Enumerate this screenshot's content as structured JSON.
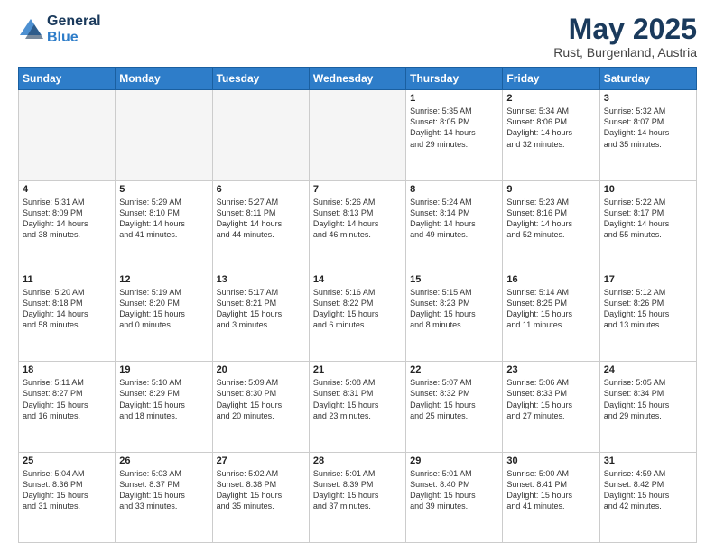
{
  "header": {
    "logo_line1": "General",
    "logo_line2": "Blue",
    "title": "May 2025",
    "subtitle": "Rust, Burgenland, Austria"
  },
  "columns": [
    "Sunday",
    "Monday",
    "Tuesday",
    "Wednesday",
    "Thursday",
    "Friday",
    "Saturday"
  ],
  "weeks": [
    [
      {
        "day": "",
        "text": "",
        "empty": true
      },
      {
        "day": "",
        "text": "",
        "empty": true
      },
      {
        "day": "",
        "text": "",
        "empty": true
      },
      {
        "day": "",
        "text": "",
        "empty": true
      },
      {
        "day": "1",
        "text": "Sunrise: 5:35 AM\nSunset: 8:05 PM\nDaylight: 14 hours\nand 29 minutes.",
        "empty": false
      },
      {
        "day": "2",
        "text": "Sunrise: 5:34 AM\nSunset: 8:06 PM\nDaylight: 14 hours\nand 32 minutes.",
        "empty": false
      },
      {
        "day": "3",
        "text": "Sunrise: 5:32 AM\nSunset: 8:07 PM\nDaylight: 14 hours\nand 35 minutes.",
        "empty": false
      }
    ],
    [
      {
        "day": "4",
        "text": "Sunrise: 5:31 AM\nSunset: 8:09 PM\nDaylight: 14 hours\nand 38 minutes.",
        "empty": false
      },
      {
        "day": "5",
        "text": "Sunrise: 5:29 AM\nSunset: 8:10 PM\nDaylight: 14 hours\nand 41 minutes.",
        "empty": false
      },
      {
        "day": "6",
        "text": "Sunrise: 5:27 AM\nSunset: 8:11 PM\nDaylight: 14 hours\nand 44 minutes.",
        "empty": false
      },
      {
        "day": "7",
        "text": "Sunrise: 5:26 AM\nSunset: 8:13 PM\nDaylight: 14 hours\nand 46 minutes.",
        "empty": false
      },
      {
        "day": "8",
        "text": "Sunrise: 5:24 AM\nSunset: 8:14 PM\nDaylight: 14 hours\nand 49 minutes.",
        "empty": false
      },
      {
        "day": "9",
        "text": "Sunrise: 5:23 AM\nSunset: 8:16 PM\nDaylight: 14 hours\nand 52 minutes.",
        "empty": false
      },
      {
        "day": "10",
        "text": "Sunrise: 5:22 AM\nSunset: 8:17 PM\nDaylight: 14 hours\nand 55 minutes.",
        "empty": false
      }
    ],
    [
      {
        "day": "11",
        "text": "Sunrise: 5:20 AM\nSunset: 8:18 PM\nDaylight: 14 hours\nand 58 minutes.",
        "empty": false
      },
      {
        "day": "12",
        "text": "Sunrise: 5:19 AM\nSunset: 8:20 PM\nDaylight: 15 hours\nand 0 minutes.",
        "empty": false
      },
      {
        "day": "13",
        "text": "Sunrise: 5:17 AM\nSunset: 8:21 PM\nDaylight: 15 hours\nand 3 minutes.",
        "empty": false
      },
      {
        "day": "14",
        "text": "Sunrise: 5:16 AM\nSunset: 8:22 PM\nDaylight: 15 hours\nand 6 minutes.",
        "empty": false
      },
      {
        "day": "15",
        "text": "Sunrise: 5:15 AM\nSunset: 8:23 PM\nDaylight: 15 hours\nand 8 minutes.",
        "empty": false
      },
      {
        "day": "16",
        "text": "Sunrise: 5:14 AM\nSunset: 8:25 PM\nDaylight: 15 hours\nand 11 minutes.",
        "empty": false
      },
      {
        "day": "17",
        "text": "Sunrise: 5:12 AM\nSunset: 8:26 PM\nDaylight: 15 hours\nand 13 minutes.",
        "empty": false
      }
    ],
    [
      {
        "day": "18",
        "text": "Sunrise: 5:11 AM\nSunset: 8:27 PM\nDaylight: 15 hours\nand 16 minutes.",
        "empty": false
      },
      {
        "day": "19",
        "text": "Sunrise: 5:10 AM\nSunset: 8:29 PM\nDaylight: 15 hours\nand 18 minutes.",
        "empty": false
      },
      {
        "day": "20",
        "text": "Sunrise: 5:09 AM\nSunset: 8:30 PM\nDaylight: 15 hours\nand 20 minutes.",
        "empty": false
      },
      {
        "day": "21",
        "text": "Sunrise: 5:08 AM\nSunset: 8:31 PM\nDaylight: 15 hours\nand 23 minutes.",
        "empty": false
      },
      {
        "day": "22",
        "text": "Sunrise: 5:07 AM\nSunset: 8:32 PM\nDaylight: 15 hours\nand 25 minutes.",
        "empty": false
      },
      {
        "day": "23",
        "text": "Sunrise: 5:06 AM\nSunset: 8:33 PM\nDaylight: 15 hours\nand 27 minutes.",
        "empty": false
      },
      {
        "day": "24",
        "text": "Sunrise: 5:05 AM\nSunset: 8:34 PM\nDaylight: 15 hours\nand 29 minutes.",
        "empty": false
      }
    ],
    [
      {
        "day": "25",
        "text": "Sunrise: 5:04 AM\nSunset: 8:36 PM\nDaylight: 15 hours\nand 31 minutes.",
        "empty": false
      },
      {
        "day": "26",
        "text": "Sunrise: 5:03 AM\nSunset: 8:37 PM\nDaylight: 15 hours\nand 33 minutes.",
        "empty": false
      },
      {
        "day": "27",
        "text": "Sunrise: 5:02 AM\nSunset: 8:38 PM\nDaylight: 15 hours\nand 35 minutes.",
        "empty": false
      },
      {
        "day": "28",
        "text": "Sunrise: 5:01 AM\nSunset: 8:39 PM\nDaylight: 15 hours\nand 37 minutes.",
        "empty": false
      },
      {
        "day": "29",
        "text": "Sunrise: 5:01 AM\nSunset: 8:40 PM\nDaylight: 15 hours\nand 39 minutes.",
        "empty": false
      },
      {
        "day": "30",
        "text": "Sunrise: 5:00 AM\nSunset: 8:41 PM\nDaylight: 15 hours\nand 41 minutes.",
        "empty": false
      },
      {
        "day": "31",
        "text": "Sunrise: 4:59 AM\nSunset: 8:42 PM\nDaylight: 15 hours\nand 42 minutes.",
        "empty": false
      }
    ]
  ]
}
